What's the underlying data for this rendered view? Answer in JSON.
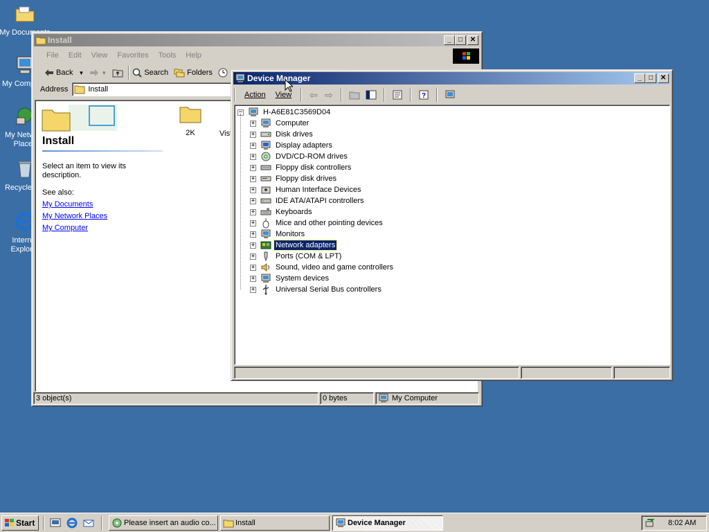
{
  "desktop": {
    "icons": [
      {
        "label": "My Documents"
      },
      {
        "label": "My Computer"
      },
      {
        "label": "My Network Places"
      },
      {
        "label": "Recycle Bin"
      },
      {
        "label": "Internet Explorer"
      }
    ]
  },
  "explorer": {
    "title": "Install",
    "menu": [
      "File",
      "Edit",
      "View",
      "Favorites",
      "Tools",
      "Help"
    ],
    "toolbar": {
      "back": "Back",
      "search": "Search",
      "folders": "Folders"
    },
    "address_label": "Address",
    "address_value": "Install",
    "panel_title": "Install",
    "panel_desc": "Select an item to view its description.",
    "see_also": "See also:",
    "links": [
      "My Documents",
      "My Network Places",
      "My Computer"
    ],
    "items": [
      "2K",
      "Vista"
    ],
    "status": {
      "objects": "3 object(s)",
      "size": "0 bytes",
      "location": "My Computer"
    }
  },
  "devmgr": {
    "title": "Device Manager",
    "menu": [
      "Action",
      "View"
    ],
    "root": "H-A6E81C3569D04",
    "items": [
      {
        "label": "Computer",
        "icon": "computer-icon"
      },
      {
        "label": "Disk drives",
        "icon": "disk-drive-icon"
      },
      {
        "label": "Display adapters",
        "icon": "display-adapter-icon"
      },
      {
        "label": "DVD/CD-ROM drives",
        "icon": "cdrom-icon"
      },
      {
        "label": "Floppy disk controllers",
        "icon": "controller-icon"
      },
      {
        "label": "Floppy disk drives",
        "icon": "floppy-drive-icon"
      },
      {
        "label": "Human Interface Devices",
        "icon": "hid-icon"
      },
      {
        "label": "IDE ATA/ATAPI controllers",
        "icon": "ide-controller-icon"
      },
      {
        "label": "Keyboards",
        "icon": "keyboard-icon"
      },
      {
        "label": "Mice and other pointing devices",
        "icon": "mouse-icon"
      },
      {
        "label": "Monitors",
        "icon": "monitor-icon"
      },
      {
        "label": "Network adapters",
        "icon": "network-adapter-icon",
        "selected": true
      },
      {
        "label": "Ports (COM & LPT)",
        "icon": "port-icon"
      },
      {
        "label": "Sound, video and game controllers",
        "icon": "sound-icon"
      },
      {
        "label": "System devices",
        "icon": "system-device-icon"
      },
      {
        "label": "Universal Serial Bus controllers",
        "icon": "usb-icon"
      }
    ]
  },
  "taskbar": {
    "start": "Start",
    "tasks": [
      {
        "label": "Please insert an audio co...",
        "active": false
      },
      {
        "label": "Install",
        "active": false
      },
      {
        "label": "Device Manager",
        "active": true
      }
    ],
    "clock": "8:02 AM"
  },
  "colors": {
    "desktop": "#3a6ea5",
    "title_active": "#0a246a",
    "selection": "#0a246a",
    "face": "#d4d0c8"
  }
}
